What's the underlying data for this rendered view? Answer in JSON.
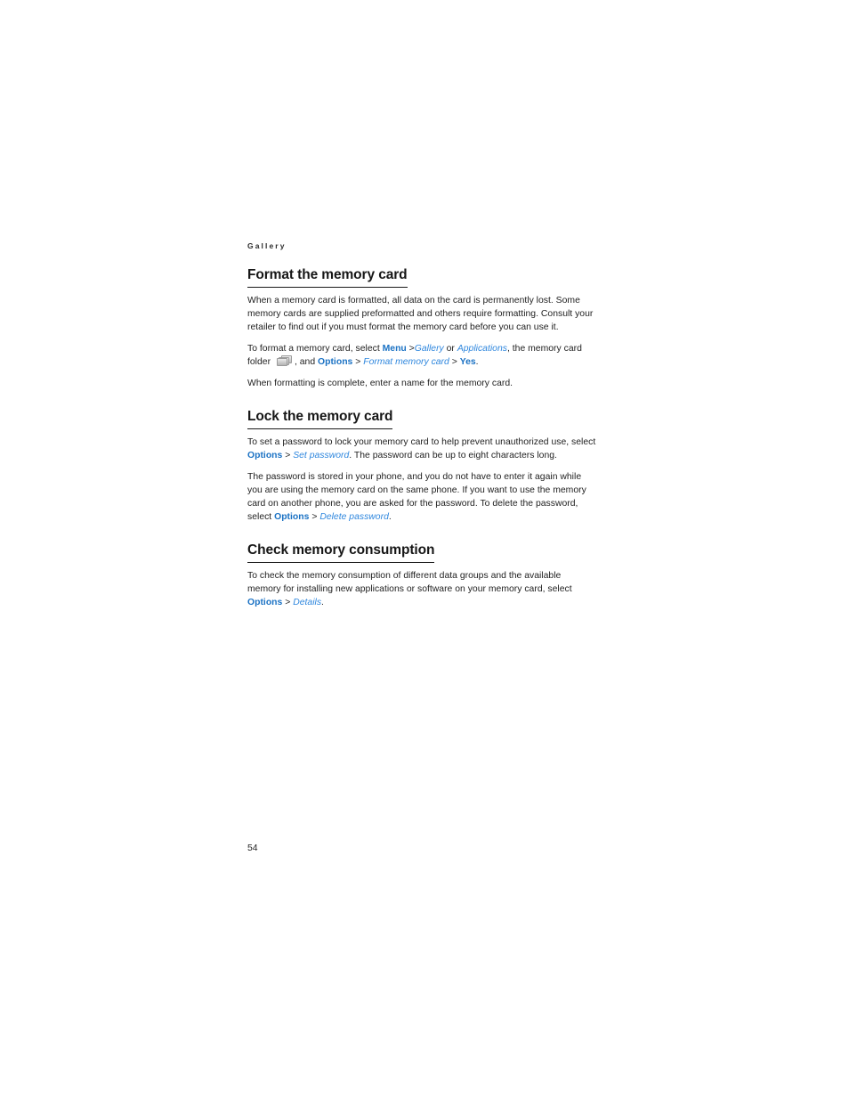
{
  "document": {
    "running_header": "Gallery",
    "page_number": "54",
    "accent_link_bold_color": "#1b72c4",
    "accent_link_italic_color": "#2f87de",
    "body_text_color": "#222222",
    "heading_color": "#161616",
    "page_background": "#ffffff"
  },
  "sections": [
    {
      "heading": "Format the memory card",
      "paragraphs": [
        {
          "runs": [
            {
              "text": "When a memory card is formatted, all data on the card is permanently lost. Some memory cards are supplied preformatted and others require formatting. Consult your retailer to find out if you must format the memory card before you can use it.",
              "style": "plain"
            }
          ]
        },
        {
          "runs": [
            {
              "text": "To format a memory card, select ",
              "style": "plain"
            },
            {
              "text": "Menu",
              "style": "ui-bold"
            },
            {
              "text": " >",
              "style": "plain"
            },
            {
              "text": "Gallery",
              "style": "ui-italic"
            },
            {
              "text": " or ",
              "style": "plain"
            },
            {
              "text": "Applications",
              "style": "ui-italic"
            },
            {
              "text": ", the memory card folder ",
              "style": "plain"
            },
            {
              "text": "gallery-folder-icon",
              "style": "icon"
            },
            {
              "text": ", and ",
              "style": "plain"
            },
            {
              "text": "Options",
              "style": "ui-bold"
            },
            {
              "text": " > ",
              "style": "plain"
            },
            {
              "text": "Format memory card",
              "style": "ui-italic"
            },
            {
              "text": " > ",
              "style": "plain"
            },
            {
              "text": "Yes",
              "style": "ui-bold"
            },
            {
              "text": ".",
              "style": "plain"
            }
          ]
        },
        {
          "runs": [
            {
              "text": "When formatting is complete, enter a name for the memory card.",
              "style": "plain"
            }
          ]
        }
      ]
    },
    {
      "heading": "Lock the memory card",
      "paragraphs": [
        {
          "runs": [
            {
              "text": "To set a password to lock your memory card to help prevent unauthorized use, select ",
              "style": "plain"
            },
            {
              "text": "Options",
              "style": "ui-bold"
            },
            {
              "text": " > ",
              "style": "plain"
            },
            {
              "text": "Set password",
              "style": "ui-italic"
            },
            {
              "text": ". The password can be up to eight characters long.",
              "style": "plain"
            }
          ]
        },
        {
          "runs": [
            {
              "text": "The password is stored in your phone, and you do not have to enter it again while you are using the memory card on the same phone. If you want to use the memory card on another phone, you are asked for the password. To delete the password, select ",
              "style": "plain"
            },
            {
              "text": "Options",
              "style": "ui-bold"
            },
            {
              "text": " > ",
              "style": "plain"
            },
            {
              "text": "Delete password",
              "style": "ui-italic"
            },
            {
              "text": ".",
              "style": "plain"
            }
          ]
        }
      ]
    },
    {
      "heading": "Check memory consumption",
      "paragraphs": [
        {
          "runs": [
            {
              "text": "To check the memory consumption of different data groups and the available memory for installing new applications or software on your memory card, select ",
              "style": "plain"
            },
            {
              "text": "Options",
              "style": "ui-bold"
            },
            {
              "text": " > ",
              "style": "plain"
            },
            {
              "text": "Details",
              "style": "ui-italic"
            },
            {
              "text": ".",
              "style": "plain"
            }
          ]
        }
      ]
    }
  ]
}
